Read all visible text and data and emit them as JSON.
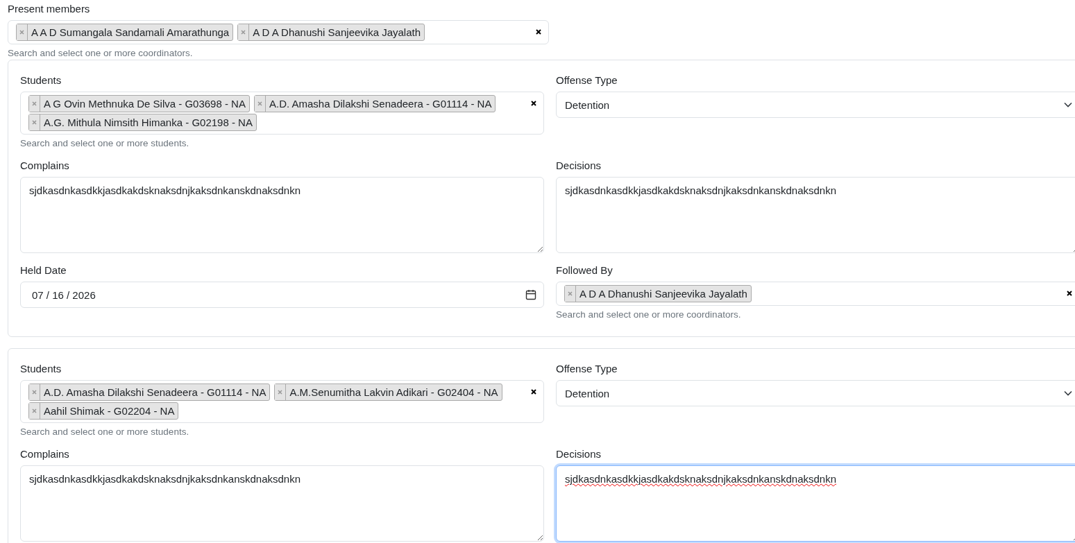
{
  "present_members": {
    "label": "Present members",
    "selected": [
      "A A D Sumangala Sandamali Amarathunga",
      "A D A Dhanushi Sanjeevika Jayalath"
    ],
    "help": "Search and select one or more coordinators."
  },
  "offenses": [
    {
      "students": {
        "label": "Students",
        "selected": [
          "A G Ovin Methnuka De Silva - G03698 - NA",
          "A.D. Amasha Dilakshi Senadeera - G01114 - NA",
          "A.G. Mithula Nimsith Himanka - G02198 - NA"
        ],
        "help": "Search and select one or more students."
      },
      "offense_type": {
        "label": "Offense Type",
        "value": "Detention"
      },
      "complains": {
        "label": "Complains",
        "value": "sjdkasdnkasdkkjasdkakdsknaksdnjkaksdnkanskdnaksdnkn",
        "focused": false,
        "misspelled": false
      },
      "decisions": {
        "label": "Decisions",
        "value": "sjdkasdnkasdkkjasdkakdsknaksdnjkaksdnkanskdnaksdnkn",
        "focused": false,
        "misspelled": false
      },
      "held_date": {
        "label": "Held Date",
        "value": "07 / 16 / 2026"
      },
      "followed_by": {
        "label": "Followed By",
        "selected": [
          "A D A Dhanushi Sanjeevika Jayalath"
        ],
        "help": "Search and select one or more coordinators."
      }
    },
    {
      "students": {
        "label": "Students",
        "selected": [
          "A.D. Amasha Dilakshi Senadeera - G01114 - NA",
          "A.M.Senumitha Lakvin Adikari - G02404 - NA",
          "Aahil Shimak - G02204 - NA"
        ],
        "help": "Search and select one or more students."
      },
      "offense_type": {
        "label": "Offense Type",
        "value": "Detention"
      },
      "complains": {
        "label": "Complains",
        "value": "sjdkasdnkasdkkjasdkakdsknaksdnjkaksdnkanskdnaksdnkn",
        "focused": false,
        "misspelled": false
      },
      "decisions": {
        "label": "Decisions",
        "value": "sjdkasdnkasdkkjasdkakdsknaksdnjkaksdnkanskdnaksdnkn",
        "focused": true,
        "misspelled": true
      }
    }
  ]
}
